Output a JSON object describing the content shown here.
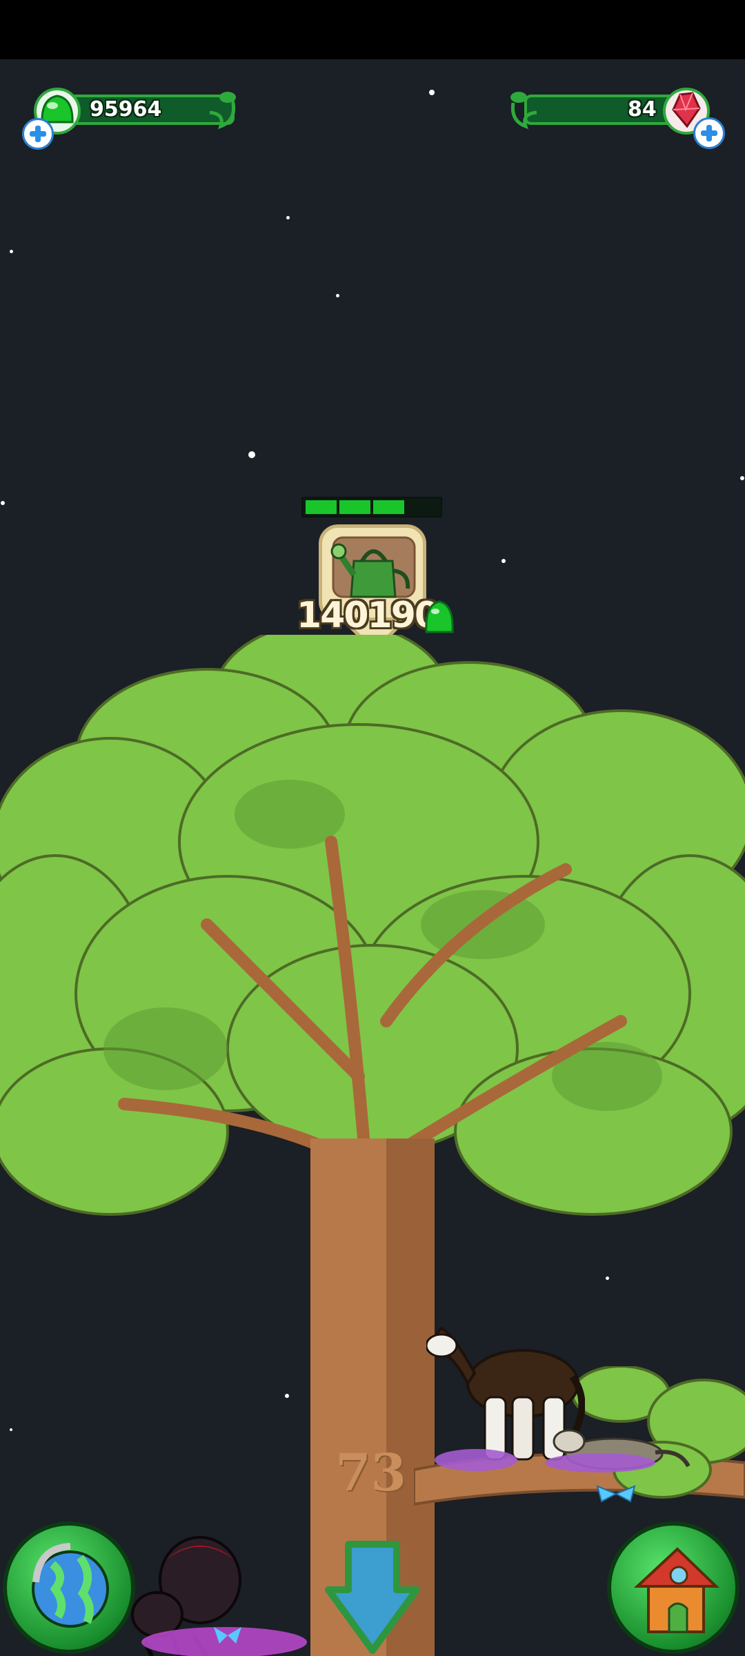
{
  "hud": {
    "gumdrops": "95964",
    "gems": "84"
  },
  "task": {
    "reward": "140190",
    "icon": "watering-can-icon",
    "progress_filled": 3,
    "progress_total": 4
  },
  "tree": {
    "branch_number": "73"
  },
  "controls": {
    "left": "globe-icon",
    "center": "down-arrow-icon",
    "right": "house-icon"
  },
  "colors": {
    "accent_green": "#19c52a",
    "sky": "#1b1f26",
    "leaf": "#7fc548",
    "trunk": "#b8794a"
  }
}
